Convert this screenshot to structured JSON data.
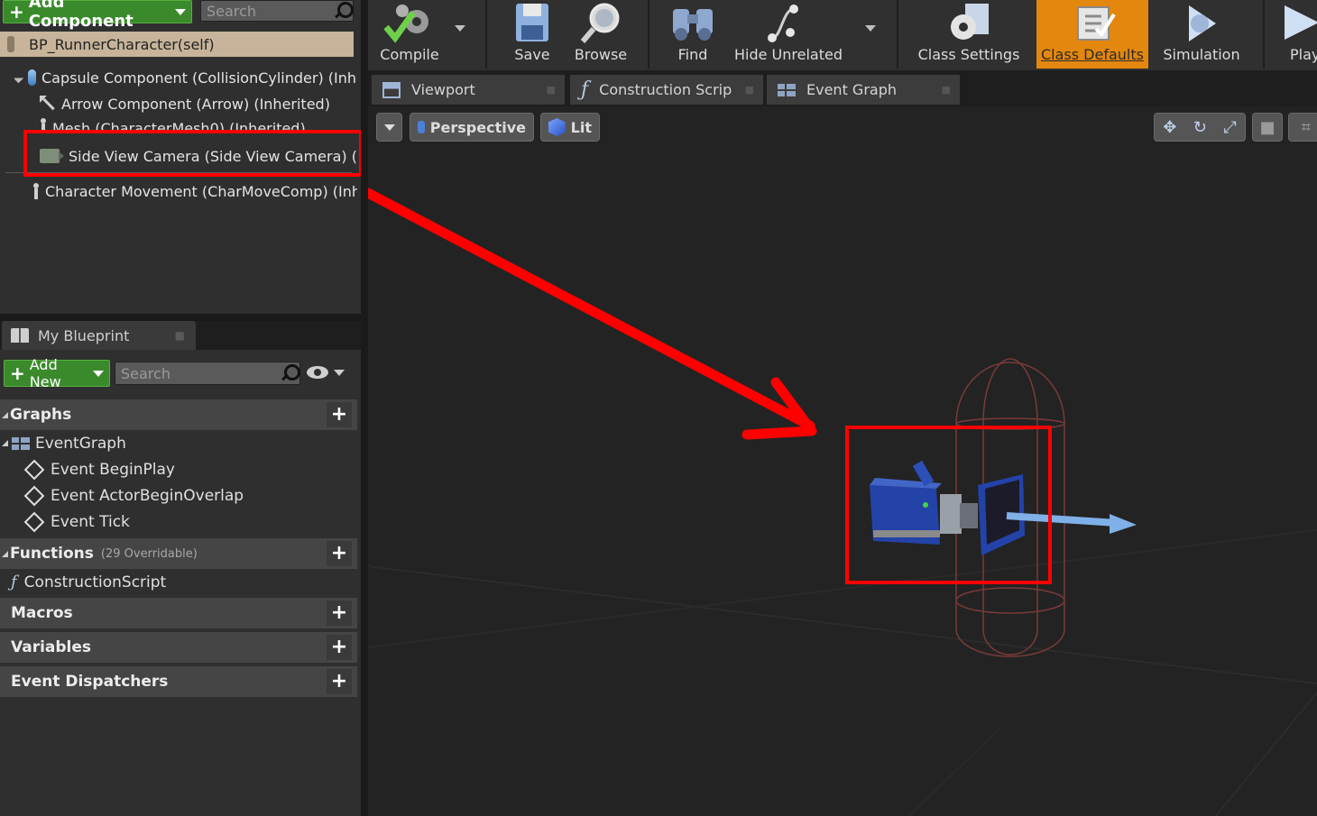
{
  "components_panel": {
    "add_component_label": "Add Component",
    "search_placeholder": "Search",
    "self_label": "BP_RunnerCharacter(self)",
    "items": [
      {
        "label": "Capsule Component (CollisionCylinder) (Inh"
      },
      {
        "label": "Arrow Component (Arrow) (Inherited)"
      },
      {
        "label": "Mesh (CharacterMesh0) (Inherited)"
      },
      {
        "label": "Side View Camera (Side View Camera) (Inh"
      },
      {
        "label": "Character Movement (CharMoveComp) (Inh"
      }
    ]
  },
  "my_blueprint": {
    "tab_label": "My Blueprint",
    "add_new_label": "Add New",
    "search_placeholder": "Search",
    "sections": {
      "graphs": "Graphs",
      "functions": "Functions",
      "functions_sub": "(29 Overridable)",
      "macros": "Macros",
      "variables": "Variables",
      "event_dispatchers": "Event Dispatchers"
    },
    "graph_items": {
      "event_graph": "EventGraph",
      "events": [
        "Event BeginPlay",
        "Event ActorBeginOverlap",
        "Event Tick"
      ]
    },
    "function_items": [
      "ConstructionScript"
    ]
  },
  "toolbar": {
    "buttons": [
      "Compile",
      "Save",
      "Browse",
      "Find",
      "Hide Unrelated",
      "Class Settings",
      "Class Defaults",
      "Simulation",
      "Play"
    ],
    "active_color": "#e4870e"
  },
  "editor_tabs": [
    "Viewport",
    "Construction Scrip",
    "Event Graph"
  ],
  "viewport": {
    "perspective_label": "Perspective",
    "lit_label": "Lit",
    "annotation_color": "#ff0000"
  }
}
